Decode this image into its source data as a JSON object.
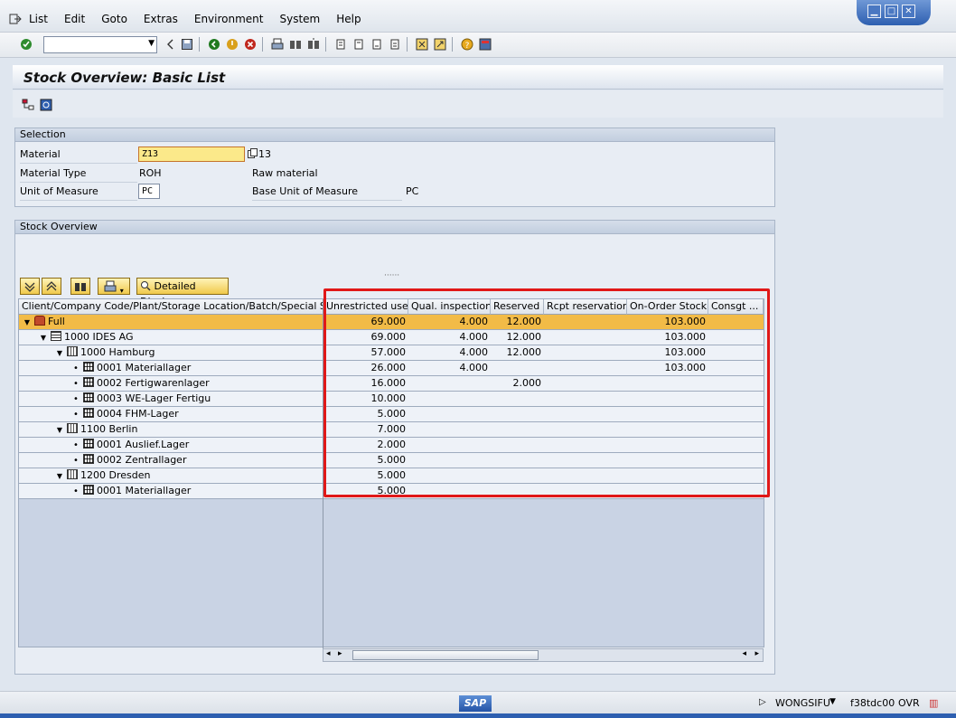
{
  "menu": [
    "List",
    "Edit",
    "Goto",
    "Extras",
    "Environment",
    "System",
    "Help"
  ],
  "toolbar": {
    "command_value": "",
    "icons": [
      "enter-icon",
      "back-icon",
      "save-icon",
      "green-back-icon",
      "exit-icon",
      "cancel-icon",
      "print-icon",
      "find-icon",
      "find-next-icon",
      "first-page-icon",
      "prev-page-icon",
      "next-page-icon",
      "last-page-icon",
      "create-session-icon",
      "shortcut-icon",
      "help-icon",
      "layout-icon"
    ]
  },
  "title": "Stock Overview: Basic List",
  "selection": {
    "header": "Selection",
    "material_label": "Material",
    "material_value": "Z13",
    "material_desc": "13",
    "type_label": "Material Type",
    "type_value": "ROH",
    "type_desc": "Raw material",
    "uom_label": "Unit of Measure",
    "uom_value": "PC",
    "base_uom_label": "Base Unit of Measure",
    "base_uom_value": "PC"
  },
  "overview": {
    "header": "Stock Overview",
    "detailed_display": "Detailed Display",
    "columns": [
      "Client/Company Code/Plant/Storage Location/Batch/Special Stock",
      "Unrestricted use",
      "Qual. inspection",
      "Reserved",
      "Rcpt reservation",
      "On-Order Stock",
      "Consgt ..."
    ],
    "rows": [
      {
        "label": "Full",
        "icon": "full",
        "node": "tri",
        "level": 0,
        "unrestricted": "69.000",
        "qual": "4.000",
        "reserved": "12.000",
        "rcpt": "",
        "onorder": "103.000",
        "consgt": ""
      },
      {
        "label": "1000 IDES AG",
        "icon": "comp",
        "node": "tri",
        "level": 1,
        "unrestricted": "69.000",
        "qual": "4.000",
        "reserved": "12.000",
        "rcpt": "",
        "onorder": "103.000",
        "consgt": ""
      },
      {
        "label": "1000 Hamburg",
        "icon": "plant",
        "node": "tri",
        "level": 2,
        "unrestricted": "57.000",
        "qual": "4.000",
        "reserved": "12.000",
        "rcpt": "",
        "onorder": "103.000",
        "consgt": ""
      },
      {
        "label": "0001 Materiallager",
        "icon": "sloc",
        "node": "dot",
        "level": 3,
        "unrestricted": "26.000",
        "qual": "4.000",
        "reserved": "",
        "rcpt": "",
        "onorder": "103.000",
        "consgt": ""
      },
      {
        "label": "0002 Fertigwarenlager",
        "icon": "sloc",
        "node": "dot",
        "level": 3,
        "unrestricted": "16.000",
        "qual": "",
        "reserved": "2.000",
        "rcpt": "",
        "onorder": "",
        "consgt": ""
      },
      {
        "label": "0003 WE-Lager Fertigu",
        "icon": "sloc",
        "node": "dot",
        "level": 3,
        "unrestricted": "10.000",
        "qual": "",
        "reserved": "",
        "rcpt": "",
        "onorder": "",
        "consgt": ""
      },
      {
        "label": "0004 FHM-Lager",
        "icon": "sloc",
        "node": "dot",
        "level": 3,
        "unrestricted": "5.000",
        "qual": "",
        "reserved": "",
        "rcpt": "",
        "onorder": "",
        "consgt": ""
      },
      {
        "label": "1100 Berlin",
        "icon": "plant",
        "node": "tri",
        "level": 2,
        "unrestricted": "7.000",
        "qual": "",
        "reserved": "",
        "rcpt": "",
        "onorder": "",
        "consgt": ""
      },
      {
        "label": "0001 Auslief.Lager",
        "icon": "sloc",
        "node": "dot",
        "level": 3,
        "unrestricted": "2.000",
        "qual": "",
        "reserved": "",
        "rcpt": "",
        "onorder": "",
        "consgt": ""
      },
      {
        "label": "0002 Zentrallager",
        "icon": "sloc",
        "node": "dot",
        "level": 3,
        "unrestricted": "5.000",
        "qual": "",
        "reserved": "",
        "rcpt": "",
        "onorder": "",
        "consgt": ""
      },
      {
        "label": "1200 Dresden",
        "icon": "plant",
        "node": "tri",
        "level": 2,
        "unrestricted": "5.000",
        "qual": "",
        "reserved": "",
        "rcpt": "",
        "onorder": "",
        "consgt": ""
      },
      {
        "label": "0001 Materiallager",
        "icon": "sloc",
        "node": "dot",
        "level": 3,
        "unrestricted": "5.000",
        "qual": "",
        "reserved": "",
        "rcpt": "",
        "onorder": "",
        "consgt": ""
      }
    ]
  },
  "status": {
    "logo": "SAP",
    "user": "WONGSIFU",
    "server": "f38tdc00",
    "mode": "OVR"
  },
  "colors": {
    "selected_row": "#f2bb47",
    "highlight_box": "#e01818",
    "title_blue": "#2d5fb0"
  }
}
